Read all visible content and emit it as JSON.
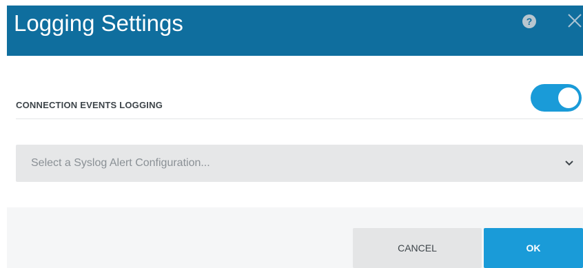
{
  "dialog": {
    "title": "Logging Settings",
    "help_icon": "question-icon",
    "close_icon": "close-icon"
  },
  "connection_logging": {
    "label": "CONNECTION EVENTS LOGGING",
    "enabled": true
  },
  "syslog_select": {
    "placeholder": "Select a Syslog Alert Configuration...",
    "chevron_icon": "chevron-down-icon"
  },
  "footer": {
    "cancel_label": "CANCEL",
    "ok_label": "OK"
  },
  "colors": {
    "header": "#0f6e9e",
    "accent": "#1a9bd8",
    "select_bg": "#e6e7e8",
    "footer_bg": "#f5f6f7"
  }
}
